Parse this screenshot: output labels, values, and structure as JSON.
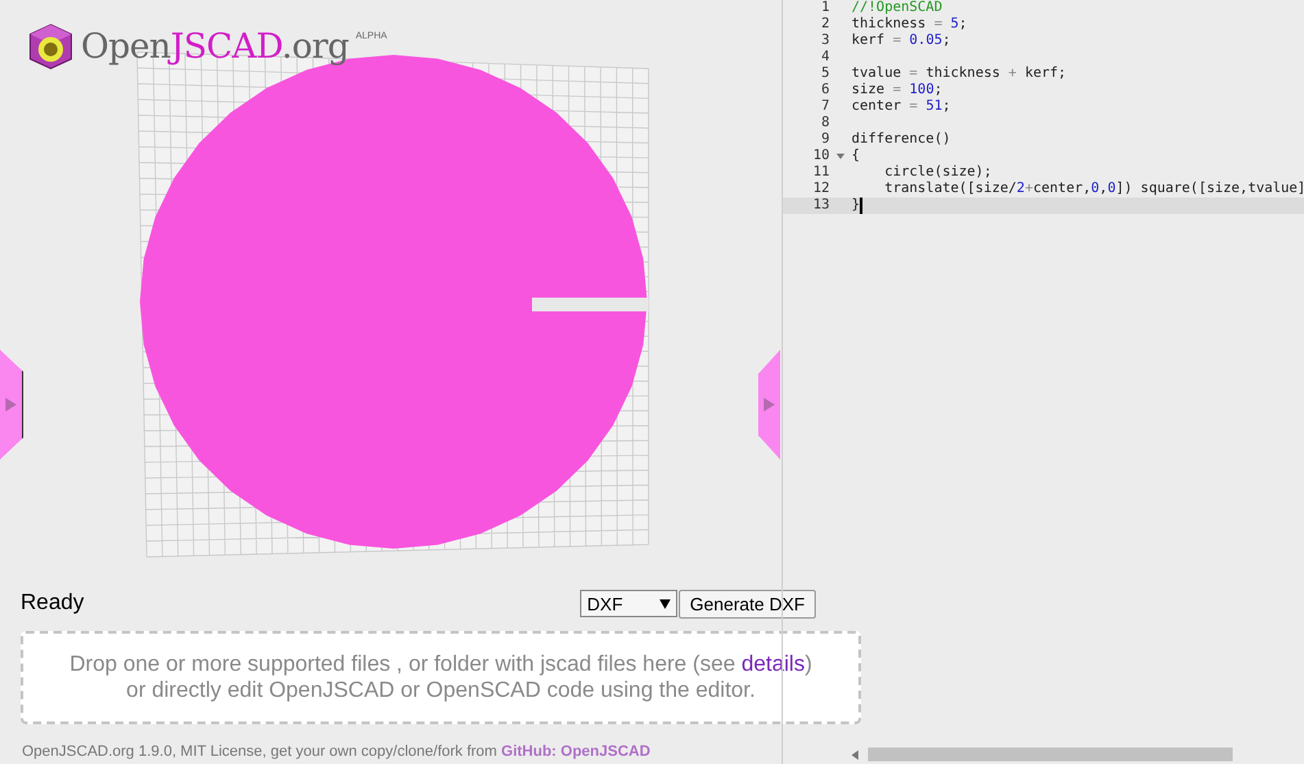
{
  "logo": {
    "parts": [
      {
        "text": "Open",
        "kind": "plain"
      },
      {
        "text": "JSCAD",
        "kind": "accent"
      },
      {
        "text": ".org",
        "kind": "plain"
      }
    ],
    "badge": "ALPHA"
  },
  "status": "Ready",
  "format_select": {
    "value": "DXF"
  },
  "generate_button": "Generate DXF",
  "drop_zone": {
    "line1": "Drop one or more supported files , or folder with jscad files here (see ",
    "link": "details",
    "after_link": ")",
    "line2": "or directly edit OpenJSCAD or OpenSCAD code using the editor."
  },
  "footer": {
    "text": "OpenJSCAD.org 1.9.0, MIT License, get your own copy/clone/fork from ",
    "link": "GitHub: OpenJSCAD"
  },
  "editor": {
    "lines": [
      {
        "number": "1",
        "active": false,
        "foldable": false,
        "tokens": [
          {
            "text": "//!OpenSCAD",
            "kind": "comment"
          }
        ]
      },
      {
        "number": "2",
        "active": false,
        "foldable": false,
        "tokens": [
          {
            "text": "thickness ",
            "kind": "plain"
          },
          {
            "text": "= ",
            "kind": "op"
          },
          {
            "text": "5",
            "kind": "number"
          },
          {
            "text": ";",
            "kind": "plain"
          }
        ]
      },
      {
        "number": "3",
        "active": false,
        "foldable": false,
        "tokens": [
          {
            "text": "kerf ",
            "kind": "plain"
          },
          {
            "text": "= ",
            "kind": "op"
          },
          {
            "text": "0.05",
            "kind": "number"
          },
          {
            "text": ";",
            "kind": "plain"
          }
        ]
      },
      {
        "number": "4",
        "active": false,
        "foldable": false
      },
      {
        "number": "5",
        "active": false,
        "foldable": false,
        "tokens": [
          {
            "text": "tvalue ",
            "kind": "plain"
          },
          {
            "text": "=",
            "kind": "op"
          },
          {
            "text": " thickness ",
            "kind": "plain"
          },
          {
            "text": "+",
            "kind": "op"
          },
          {
            "text": " kerf;",
            "kind": "plain"
          }
        ]
      },
      {
        "number": "6",
        "active": false,
        "foldable": false,
        "tokens": [
          {
            "text": "size ",
            "kind": "plain"
          },
          {
            "text": "= ",
            "kind": "op"
          },
          {
            "text": "100",
            "kind": "number"
          },
          {
            "text": ";",
            "kind": "plain"
          }
        ]
      },
      {
        "number": "7",
        "active": false,
        "foldable": false,
        "tokens": [
          {
            "text": "center ",
            "kind": "plain"
          },
          {
            "text": "= ",
            "kind": "op"
          },
          {
            "text": "51",
            "kind": "number"
          },
          {
            "text": ";",
            "kind": "plain"
          }
        ]
      },
      {
        "number": "8",
        "active": false,
        "foldable": false
      },
      {
        "number": "9",
        "active": false,
        "foldable": false,
        "tokens": [
          {
            "text": "difference()",
            "kind": "plain"
          }
        ]
      },
      {
        "number": "10",
        "active": false,
        "foldable": true,
        "tokens": [
          {
            "text": "{",
            "kind": "plain"
          }
        ]
      },
      {
        "number": "11",
        "active": false,
        "foldable": false,
        "tokens": [
          {
            "text": "    circle(size);",
            "kind": "plain"
          }
        ]
      },
      {
        "number": "12",
        "active": false,
        "foldable": false,
        "tokens": [
          {
            "text": "    translate([size/",
            "kind": "plain"
          },
          {
            "text": "2",
            "kind": "number"
          },
          {
            "text": "+",
            "kind": "op"
          },
          {
            "text": "center,",
            "kind": "plain"
          },
          {
            "text": "0",
            "kind": "number"
          },
          {
            "text": ",",
            "kind": "plain"
          },
          {
            "text": "0",
            "kind": "number"
          },
          {
            "text": "]) square([size,tvalue]",
            "kind": "plain"
          }
        ]
      },
      {
        "number": "13",
        "active": true,
        "foldable": false,
        "tokens": [
          {
            "text": "}",
            "kind": "plain"
          }
        ]
      }
    ]
  }
}
